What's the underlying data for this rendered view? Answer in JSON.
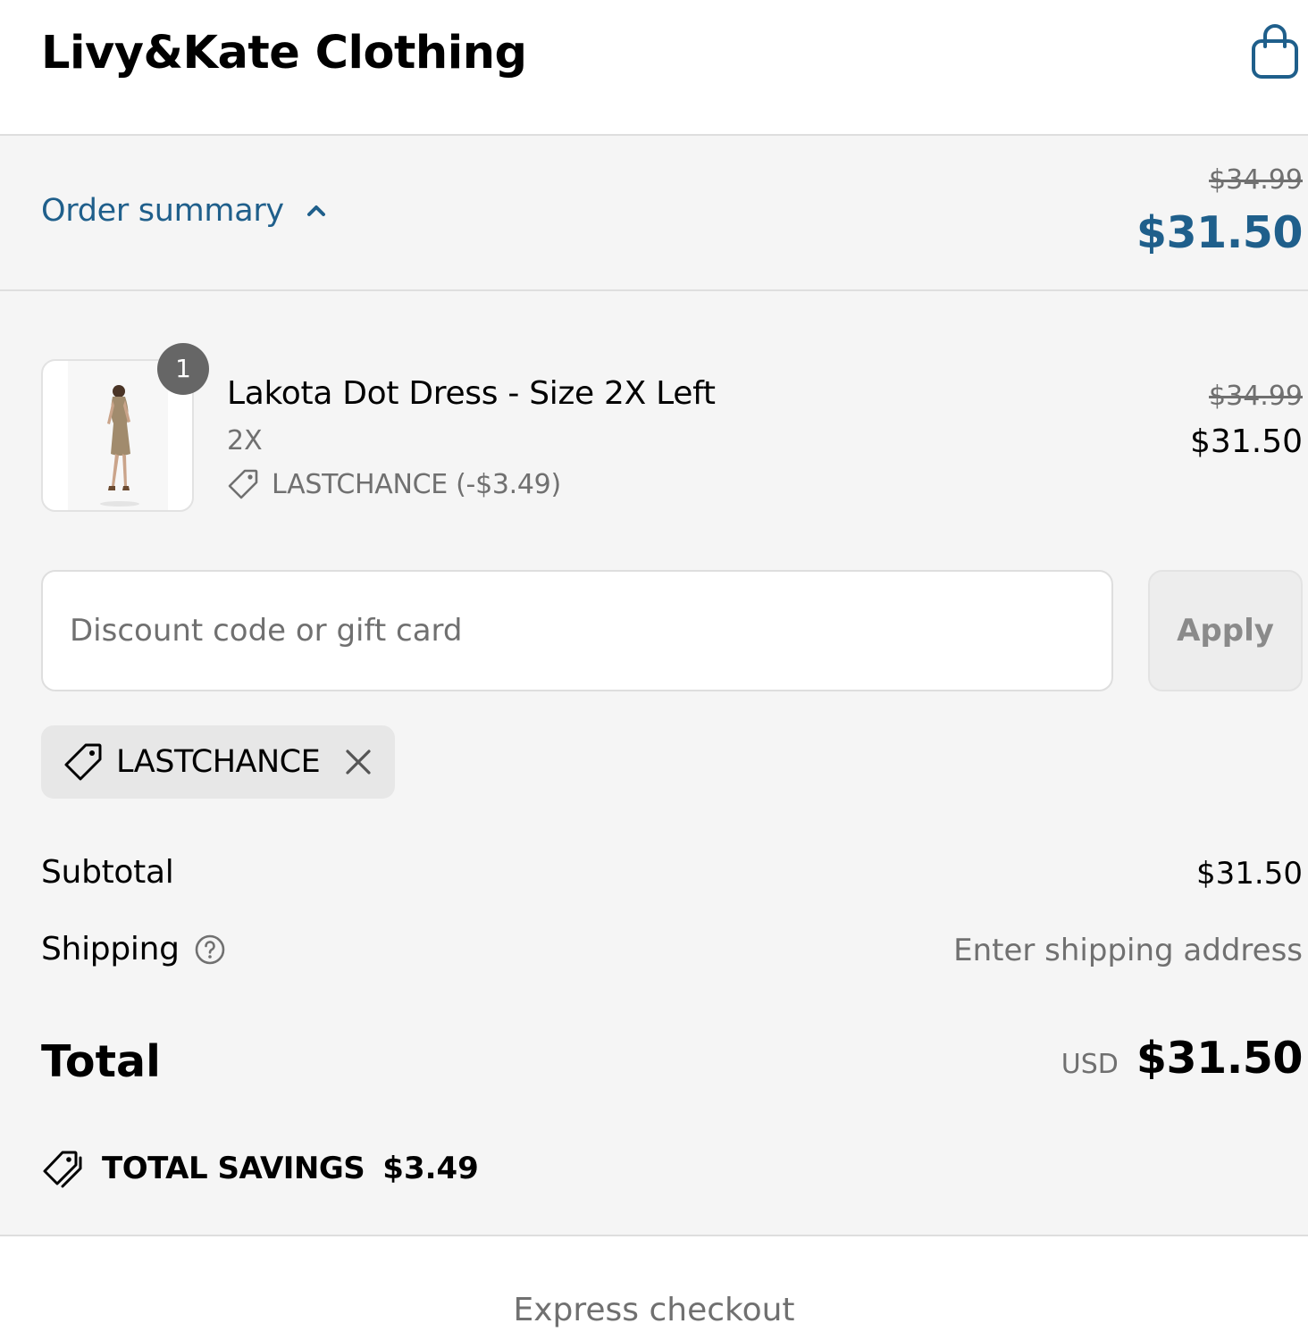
{
  "header": {
    "store_name": "Livy&Kate Clothing",
    "cart_icon": "shopping-bag-icon",
    "accent_color": "#1f5f8b"
  },
  "summary_bar": {
    "toggle_label": "Order summary",
    "toggle_icon": "chevron-up-icon",
    "compare_price": "$34.99",
    "price": "$31.50"
  },
  "line_item": {
    "quantity": "1",
    "title": "Lakota Dot Dress - Size 2X Left",
    "variant": "2X",
    "discount_icon": "tag-icon",
    "discount": "LASTCHANCE (-$3.49)",
    "compare_price": "$34.99",
    "price": "$31.50"
  },
  "discount_form": {
    "placeholder": "Discount code or gift card",
    "value": "",
    "apply_label": "Apply"
  },
  "applied_code": {
    "icon": "tag-icon",
    "code": "LASTCHANCE",
    "remove_icon": "close-icon"
  },
  "totals": {
    "subtotal_label": "Subtotal",
    "subtotal_value": "$31.50",
    "shipping_label": "Shipping",
    "shipping_help_icon": "question-circle-icon",
    "shipping_value": "Enter shipping address",
    "total_label": "Total",
    "currency": "USD",
    "total_value": "$31.50"
  },
  "savings": {
    "icon": "tags-icon",
    "label": "TOTAL SAVINGS",
    "amount": "$3.49"
  },
  "express": {
    "label": "Express checkout"
  }
}
